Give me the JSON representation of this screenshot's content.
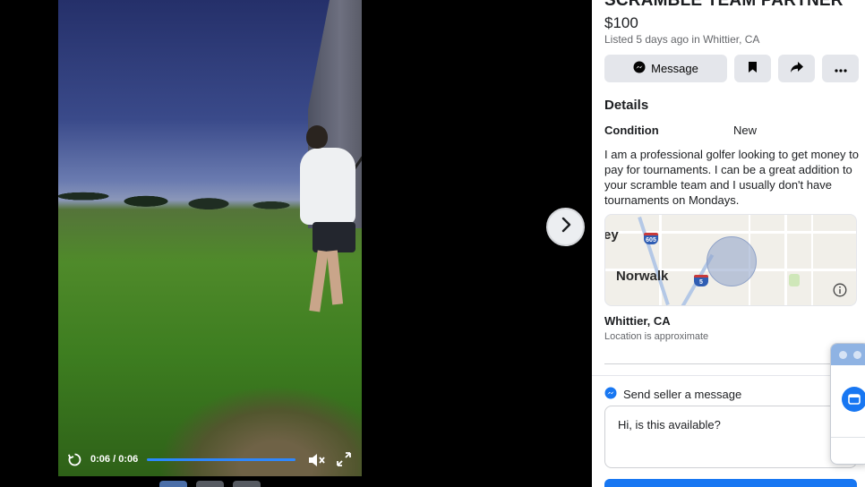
{
  "video": {
    "time_current": "0:06",
    "time_total": "0:06",
    "time_separator": "/",
    "progress": 1.0
  },
  "viewer": {
    "next_icon": "chevron-right-icon",
    "thumbnails": 3,
    "active_thumbnail": 0
  },
  "listing": {
    "title": "SCRAMBLE TEAM PARTNER",
    "price": "$100",
    "listed": "Listed 5 days ago in Whittier, CA",
    "actions": {
      "message_label": "Message",
      "save_icon": "bookmark-icon",
      "share_icon": "share-icon",
      "more_icon": "more-icon"
    },
    "details_heading": "Details",
    "condition_label": "Condition",
    "condition_value": "New",
    "description": "I am a professional golfer looking to get money to pay for tournaments. I can be a great addition to your scramble team and I usually don't have tournaments on Mondays.",
    "map": {
      "label_partial": "ey",
      "label_city": "Norwalk",
      "shield_605": "605",
      "shield_5": "5"
    },
    "location_name": "Whittier, CA",
    "location_note": "Location is approximate"
  },
  "seller_message": {
    "heading": "Send seller a message",
    "message_value": "Hi, is this available?"
  },
  "colors": {
    "accent": "#1877f2",
    "panel_bg": "#ffffff",
    "button_bg": "#e4e6eb"
  }
}
